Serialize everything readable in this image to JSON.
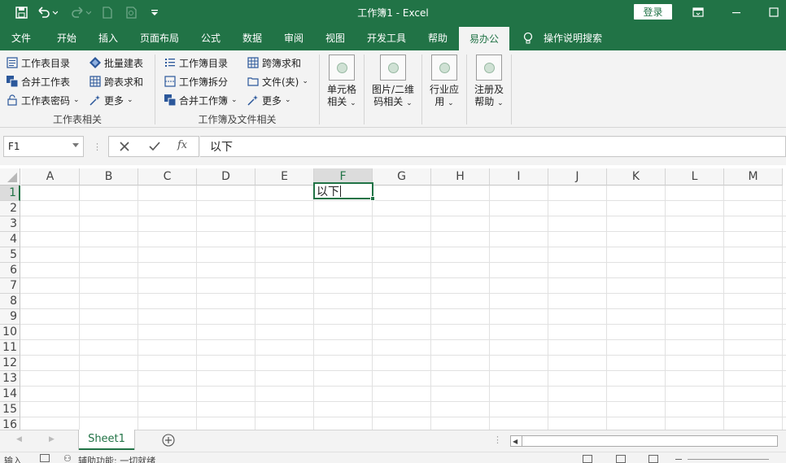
{
  "window": {
    "title": "工作簿1  -  Excel",
    "login_label": "登录"
  },
  "tabs": [
    {
      "label": "文件"
    },
    {
      "label": "开始"
    },
    {
      "label": "插入"
    },
    {
      "label": "页面布局"
    },
    {
      "label": "公式"
    },
    {
      "label": "数据"
    },
    {
      "label": "审阅"
    },
    {
      "label": "视图"
    },
    {
      "label": "开发工具"
    },
    {
      "label": "帮助"
    },
    {
      "label": "易办公",
      "active": true
    },
    {
      "label": "操作说明搜索"
    }
  ],
  "ribbon": {
    "sheet_group": {
      "label": "工作表相关",
      "buttons": [
        "工作表目录",
        "批量建表",
        "合并工作表",
        "跨表求和",
        "工作表密码",
        "更多"
      ]
    },
    "book_group": {
      "label": "工作簿及文件相关",
      "buttons": [
        "工作簿目录",
        "跨簿求和",
        "工作簿拆分",
        "文件(夹)",
        "合并工作簿",
        "更多"
      ]
    },
    "big_buttons": [
      {
        "line1": "单元格",
        "line2": "相关"
      },
      {
        "line1": "图片/二维",
        "line2": "码相关"
      },
      {
        "line1": "行业应",
        "line2": "用"
      },
      {
        "line1": "注册及",
        "line2": "帮助"
      }
    ]
  },
  "formula_bar": {
    "name_box": "F1",
    "fx": "fx",
    "value": "以下"
  },
  "grid": {
    "columns": [
      "A",
      "B",
      "C",
      "D",
      "E",
      "F",
      "G",
      "H",
      "I",
      "J",
      "K",
      "L",
      "M"
    ],
    "rows": [
      "1",
      "2",
      "3",
      "4",
      "5",
      "6",
      "7",
      "8",
      "9",
      "10",
      "11",
      "12",
      "13",
      "14",
      "15",
      "16"
    ],
    "selected_column": "F",
    "selected_row": "1",
    "active_cell_value": "以下"
  },
  "sheets": [
    {
      "label": "Sheet1",
      "active": true
    }
  ],
  "status": {
    "mode": "输入",
    "accessibility": "辅助功能: 一切就绪"
  },
  "colors": {
    "accent": "#217346",
    "ribbon_bg": "#f3f3f3"
  }
}
